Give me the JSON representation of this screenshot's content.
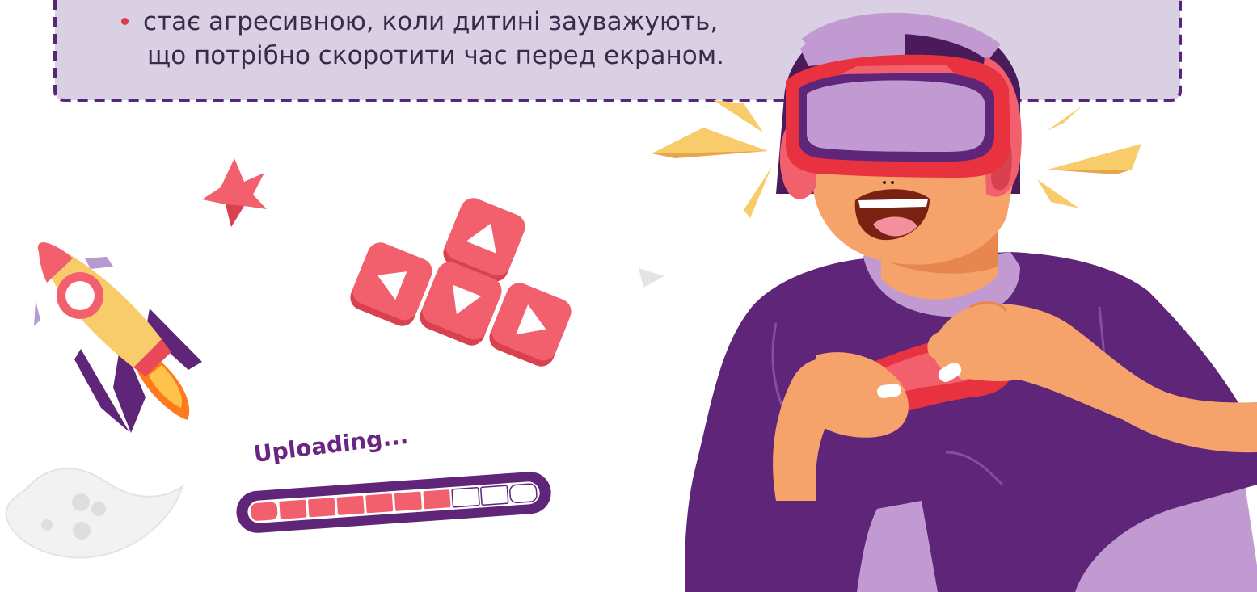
{
  "note": {
    "line_1": "стає агресивною, коли дитині зауважують,",
    "line_2": "що потрібно скоротити час перед екраном."
  },
  "upload": {
    "label": "Uploading...",
    "progress_segments_filled": 7,
    "progress_segments_total": 10
  },
  "colors": {
    "note_background": "#d9d0e4",
    "note_border": "#5a2478",
    "accent_red": "#f2606e",
    "purple": "#5e2578",
    "skin": "#f5a26b",
    "yellow": "#f9cc6b"
  }
}
